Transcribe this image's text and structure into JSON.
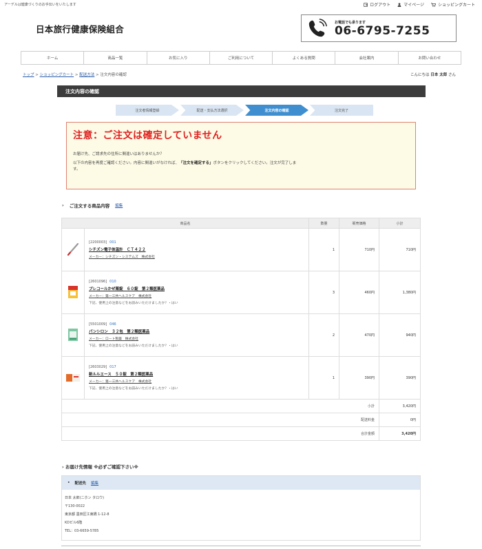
{
  "header": {
    "tagline": "アーデルは健康づくりのお手伝いをいたします",
    "top_links": [
      "ログアウト",
      "マイページ",
      "ショッピングカート"
    ],
    "site_title": "日本旅行健康保険組合",
    "phone_label": "お電話でも承ります",
    "phone_number": "06-6795-7255"
  },
  "nav": [
    "ホーム",
    "商品一覧",
    "お気に入り",
    "ご利用について",
    "よくある質問",
    "会社案内",
    "お問い合わせ"
  ],
  "breadcrumb": {
    "items": [
      "トップ",
      "ショッピングカート",
      "配送方法"
    ],
    "current": "注文内容の確認",
    "sep": " > "
  },
  "greeting": {
    "prefix": "こんにちは",
    "name": "日本 太郎",
    "suffix": "さん"
  },
  "section_title": "注文内容の確認",
  "steps": [
    "注文者情報登録",
    "配送・支払方法選択",
    "注文内容の確認",
    "注文完了"
  ],
  "warning": {
    "title": "注意：ご注文は確定していません",
    "line1": "お届け先、ご請求先の住所に間違いはありませんか？",
    "line2_pre": "以下の内容を再度ご確認ください。内容に間違いがなければ、",
    "line2_bold": "「注文を確定する」",
    "line2_post": "ボタンをクリックしてください。注文が完了しま",
    "line3": "す。"
  },
  "order": {
    "heading": "ご注文する商品内容",
    "edit_label": "編集",
    "columns": [
      "商品名",
      "数量",
      "販売価格",
      "小計"
    ],
    "rows": [
      {
        "code": "[2200003]",
        "num": "001",
        "name": "シチズン電子体温計　ＣＴ４２２",
        "maker": "メーカー：シチズン・システムズ　株式会社",
        "note": "",
        "qty": "1",
        "price": "710円",
        "subtotal": "710円"
      },
      {
        "code": "[2601096]",
        "num": "010",
        "name": "プレコールかぜ薬錠　６０錠　第２類医薬品",
        "maker": "メーカー：第一三共ヘルスケア　株式会社",
        "note": "下記、使用上の注意などをお読みいただけましたか？・はい",
        "qty": "3",
        "price": "460円",
        "subtotal": "1,380円"
      },
      {
        "code": "[5501009]",
        "num": "046",
        "name": "パンシロン　３２包　第２類医薬品",
        "maker": "メーカー：ロート製薬　株式会社",
        "note": "下記、使用上の注意などをお読みいただけましたか？・はい",
        "qty": "2",
        "price": "470円",
        "subtotal": "940円"
      },
      {
        "code": "[2603029]",
        "num": "017",
        "name": "新ルルエース　５０錠　第２類医薬品",
        "maker": "メーカー：第一三共ヘルスケア　株式会社",
        "note": "下記、使用上の注意などをお読みいただけましたか？・はい",
        "qty": "1",
        "price": "390円",
        "subtotal": "390円"
      }
    ],
    "summary": [
      {
        "label": "小計",
        "value": "3,420円"
      },
      {
        "label": "配送料金",
        "value": "0円"
      },
      {
        "label": "合計金額",
        "value": "3,420円"
      }
    ]
  },
  "shipping": {
    "heading": "お届け先情報 ※必ずご確認下さい※",
    "sub_label": "配送先",
    "edit_label": "編集",
    "lines": [
      "日本 太郎(ニホン タロウ)",
      "〒130-0022",
      "東京都 墨田区江東橋 1-12-8",
      "KDビル6階",
      "TEL：03-6659-5785"
    ]
  }
}
